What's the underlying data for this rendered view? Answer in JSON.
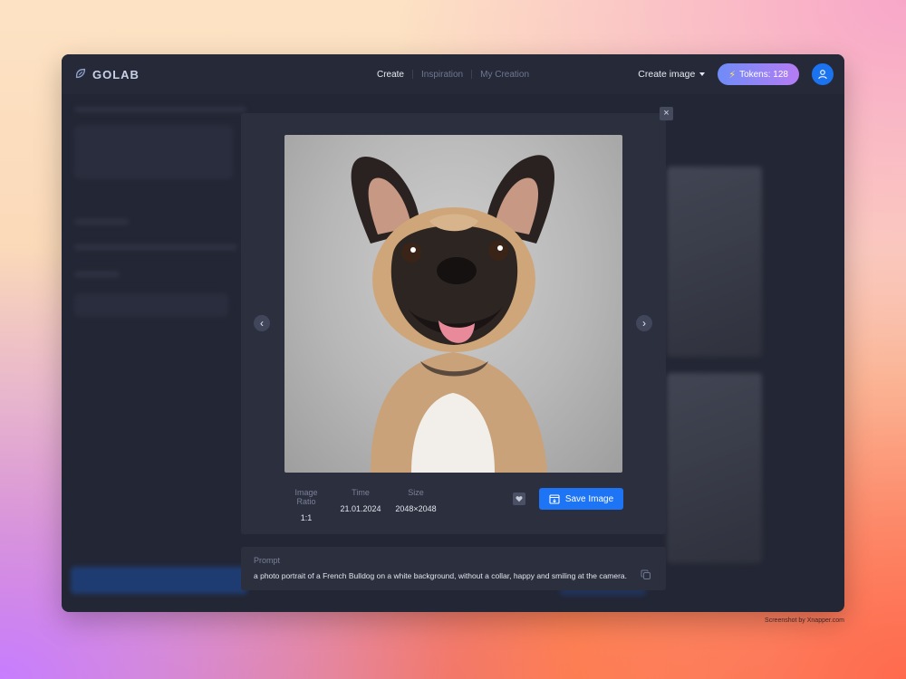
{
  "app": {
    "logo_text": "GOLAB"
  },
  "nav": {
    "items": [
      {
        "label": "Create",
        "active": true
      },
      {
        "label": "Inspiration",
        "active": false
      },
      {
        "label": "My Creation",
        "active": false
      }
    ]
  },
  "header": {
    "create_label": "Create image",
    "tokens_label": "Tokens: 128"
  },
  "modal": {
    "close_symbol": "×",
    "prev_symbol": "‹",
    "next_symbol": "›",
    "image_subject": "French Bulldog portrait",
    "meta": [
      {
        "label": "Image Ratio",
        "value": "1:1"
      },
      {
        "label": "Time",
        "value": "21.01.2024"
      },
      {
        "label": "Size",
        "value": "2048×2048"
      }
    ],
    "save_label": "Save Image"
  },
  "prompt": {
    "label": "Prompt",
    "text": "a photo portrait of a French Bulldog on a white background, without a collar, happy and smiling at the camera."
  },
  "credit": "Screenshot by Xnapper.com",
  "colors": {
    "accent": "#1d74f5",
    "app_bg": "#232634",
    "modal_bg": "#2b2f3e",
    "token_gradient_start": "#6f8cf7",
    "token_gradient_end": "#b57cf4"
  }
}
